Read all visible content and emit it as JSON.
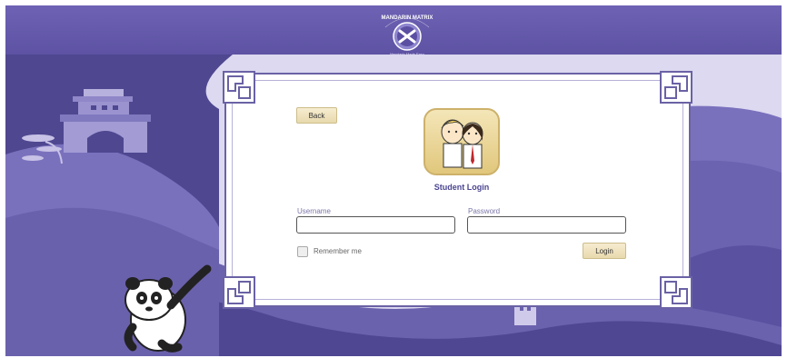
{
  "brand": {
    "name": "MANDARIN MATRIX",
    "tagline": "Mandarin Made Easy"
  },
  "login": {
    "back_label": "Back",
    "title": "Student Login",
    "username_label": "Username",
    "password_label": "Password",
    "username_value": "",
    "password_value": "",
    "remember_label": "Remember me",
    "remember_checked": false,
    "login_label": "Login"
  },
  "colors": {
    "header": "#6d62b3",
    "accent_text": "#4a4590",
    "button": "#f2e6c4",
    "scene": "#8f86c9"
  },
  "icons": [
    "mandarin-matrix-logo",
    "students-app-icon",
    "panda-mascot",
    "fretwork-corner"
  ]
}
